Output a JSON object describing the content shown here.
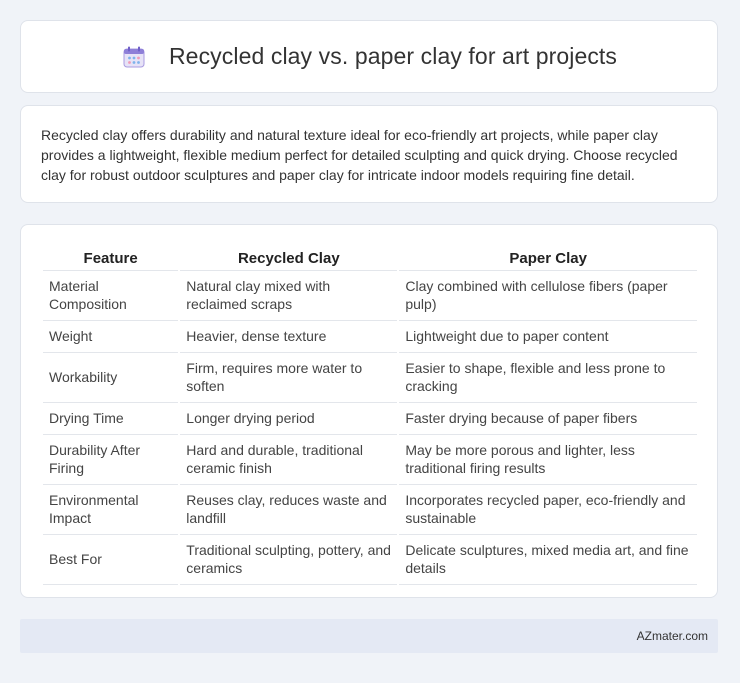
{
  "header": {
    "icon": "calendar-icon",
    "title": "Recycled clay vs. paper clay for art projects"
  },
  "summary": {
    "text": "Recycled clay offers durability and natural texture ideal for eco-friendly art projects, while paper clay provides a lightweight, flexible medium perfect for detailed sculpting and quick drying. Choose recycled clay for robust outdoor sculptures and paper clay for intricate indoor models requiring fine detail."
  },
  "table": {
    "headers": [
      "Feature",
      "Recycled Clay",
      "Paper Clay"
    ],
    "rows": [
      [
        "Material Composition",
        "Natural clay mixed with reclaimed scraps",
        "Clay combined with cellulose fibers (paper pulp)"
      ],
      [
        "Weight",
        "Heavier, dense texture",
        "Lightweight due to paper content"
      ],
      [
        "Workability",
        "Firm, requires more water to soften",
        "Easier to shape, flexible and less prone to cracking"
      ],
      [
        "Drying Time",
        "Longer drying period",
        "Faster drying because of paper fibers"
      ],
      [
        "Durability After Firing",
        "Hard and durable, traditional ceramic finish",
        "May be more porous and lighter, less traditional firing results"
      ],
      [
        "Environmental Impact",
        "Reuses clay, reduces waste and landfill",
        "Incorporates recycled paper, eco-friendly and sustainable"
      ],
      [
        "Best For",
        "Traditional sculpting, pottery, and ceramics",
        "Delicate sculptures, mixed media art, and fine details"
      ]
    ]
  },
  "footer": {
    "brand": "AZmater.com"
  }
}
